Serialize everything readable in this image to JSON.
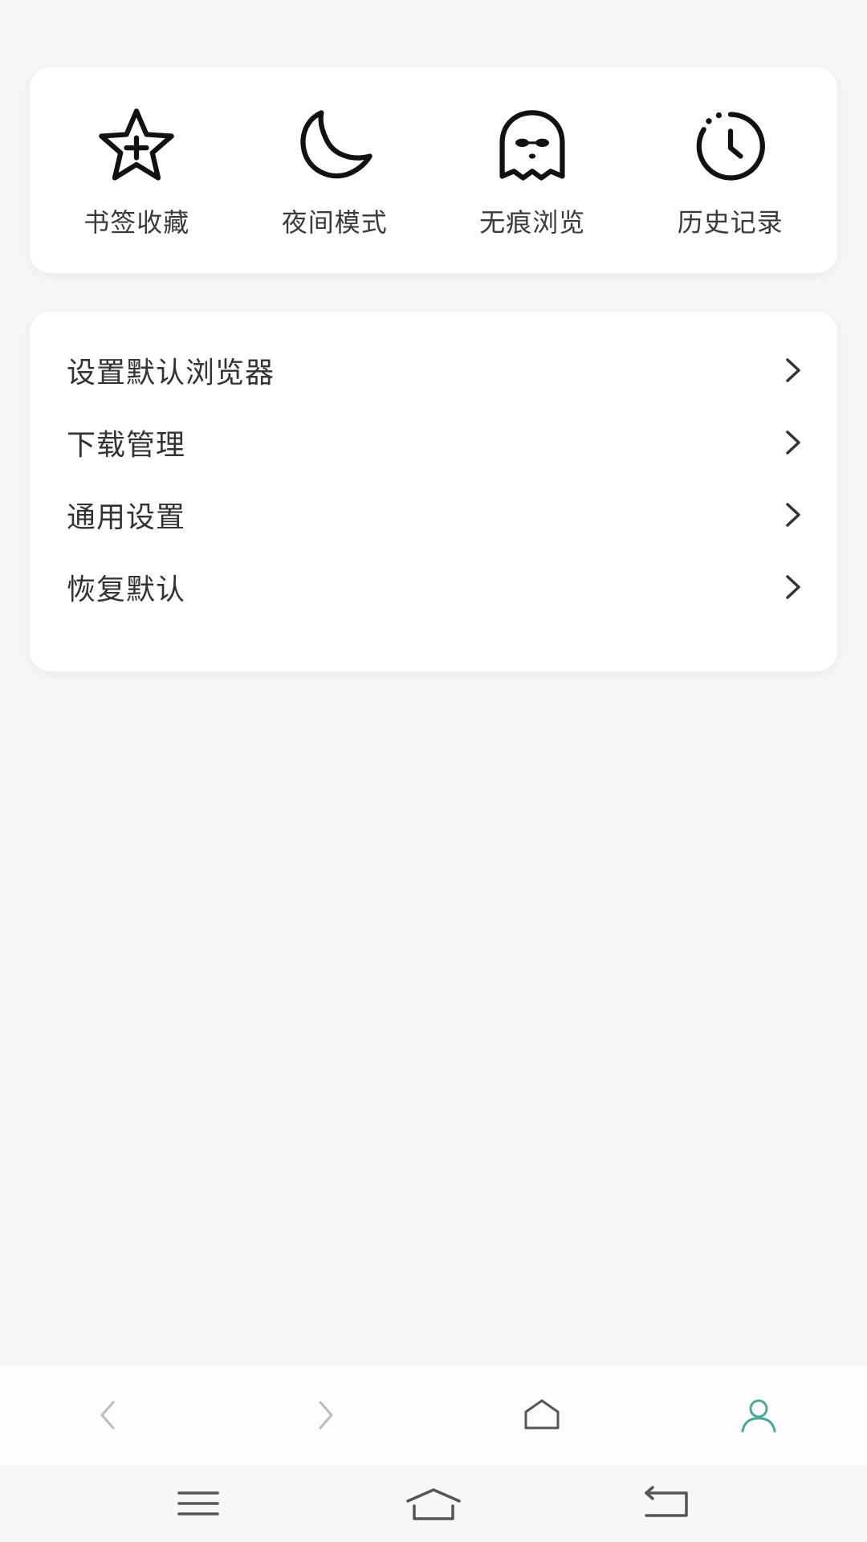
{
  "quick_actions": [
    {
      "label": "书签收藏",
      "icon": "star-plus-icon"
    },
    {
      "label": "夜间模式",
      "icon": "moon-icon"
    },
    {
      "label": "无痕浏览",
      "icon": "ghost-icon"
    },
    {
      "label": "历史记录",
      "icon": "clock-icon"
    }
  ],
  "menu": {
    "items": [
      {
        "label": "设置默认浏览器"
      },
      {
        "label": "下载管理"
      },
      {
        "label": "通用设置"
      },
      {
        "label": "恢复默认"
      }
    ]
  },
  "toolbar": {
    "buttons": [
      "back-icon",
      "forward-icon",
      "home-icon",
      "profile-icon"
    ],
    "active_color": "#4aa79a",
    "inactive_color": "#bdbdbd"
  },
  "system_nav": [
    "menu-icon",
    "home-icon",
    "back-icon"
  ]
}
